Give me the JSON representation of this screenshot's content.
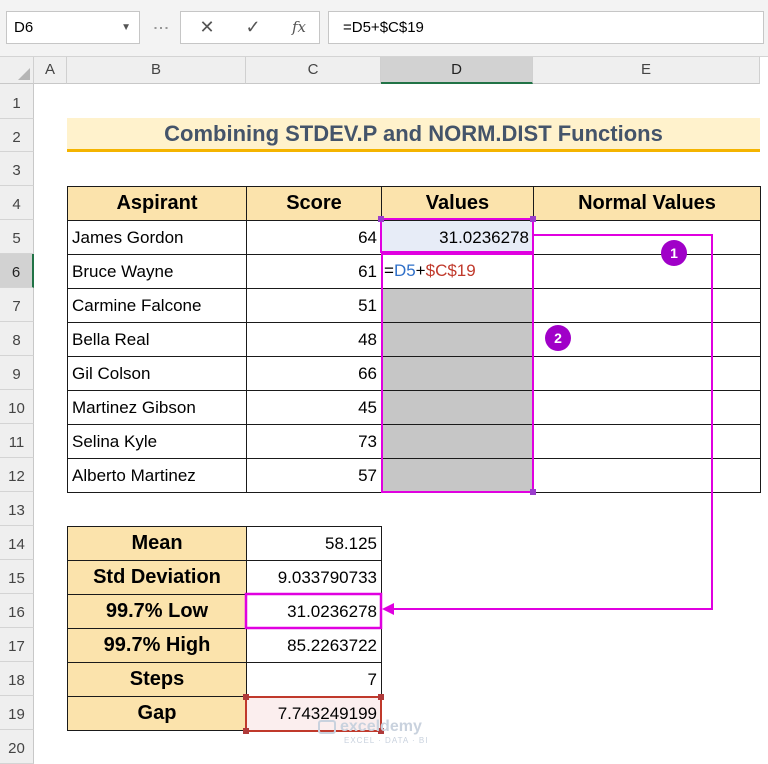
{
  "namebox": "D6",
  "formula_bar": "=D5+$C$19",
  "columns": [
    "A",
    "B",
    "C",
    "D",
    "E"
  ],
  "rows": [
    "1",
    "2",
    "3",
    "4",
    "5",
    "6",
    "7",
    "8",
    "9",
    "10",
    "11",
    "12",
    "13",
    "14",
    "15",
    "16",
    "17",
    "18",
    "19",
    "20"
  ],
  "title": "Combining STDEV.P and NORM.DIST Functions",
  "table": {
    "headers": [
      "Aspirant",
      "Score",
      "Values",
      "Normal Values"
    ],
    "rows": [
      {
        "name": "James Gordon",
        "score": "64",
        "value": "31.0236278"
      },
      {
        "name": "Bruce Wayne",
        "score": "61",
        "value": ""
      },
      {
        "name": "Carmine Falcone",
        "score": "51",
        "value": ""
      },
      {
        "name": "Bella Real",
        "score": "48",
        "value": ""
      },
      {
        "name": "Gil Colson",
        "score": "66",
        "value": ""
      },
      {
        "name": "Martinez Gibson",
        "score": "45",
        "value": ""
      },
      {
        "name": "Selina Kyle",
        "score": "73",
        "value": ""
      },
      {
        "name": "Alberto Martinez",
        "score": "57",
        "value": ""
      }
    ]
  },
  "editing_formula": {
    "prefix": "=",
    "ref1": "D5",
    "op": "+",
    "ref2": "$C$19"
  },
  "stats": [
    {
      "label": "Mean",
      "value": "58.125"
    },
    {
      "label": "Std Deviation",
      "value": "9.033790733"
    },
    {
      "label": "99.7% Low",
      "value": "31.0236278"
    },
    {
      "label": "99.7% High",
      "value": "85.2263722"
    },
    {
      "label": "Steps",
      "value": "7"
    },
    {
      "label": "Gap",
      "value": "7.743249199"
    }
  ],
  "badges": [
    "1",
    "2"
  ],
  "watermark": {
    "name": "exceldemy",
    "tagline": "EXCEL · DATA · BI"
  },
  "colors": {
    "header_fill": "#fbe3ac",
    "title_fill": "#fff2cc",
    "accent": "#e000e0",
    "badge": "#a000c8",
    "ref_blue": "#2f6fc8",
    "ref_red": "#c0392b"
  }
}
